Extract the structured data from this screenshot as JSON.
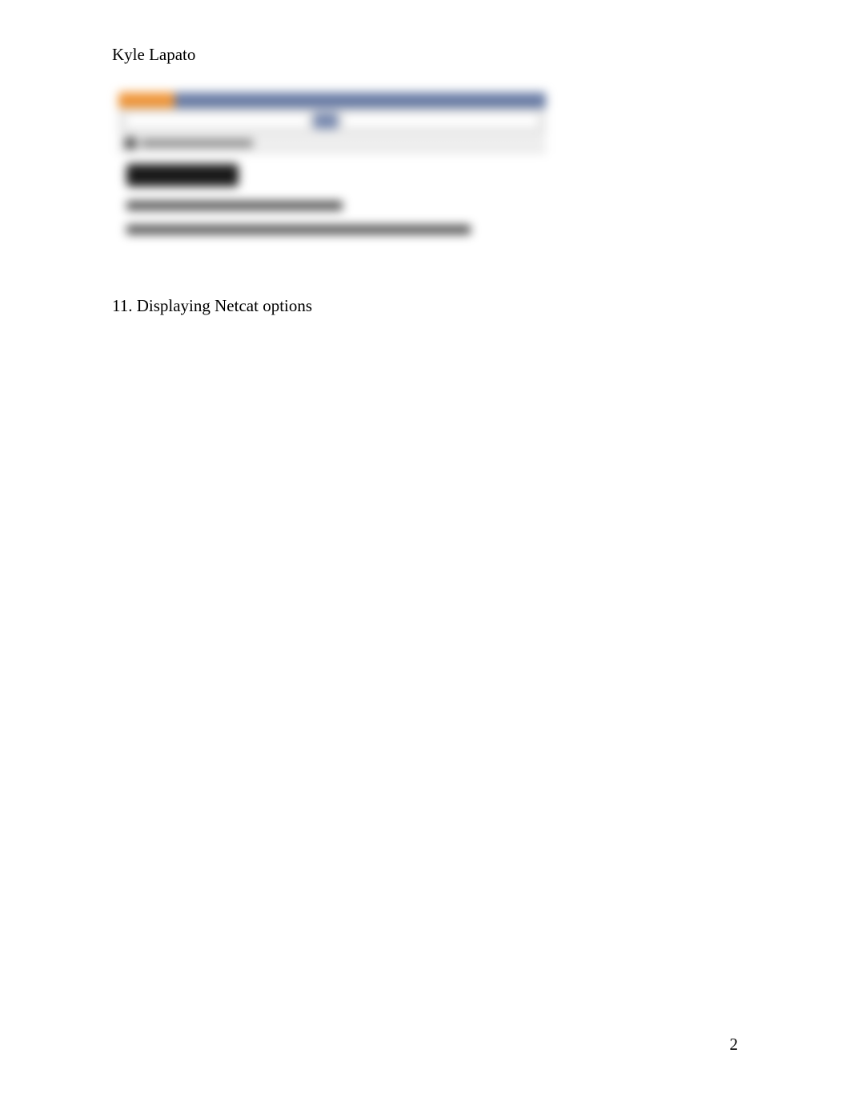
{
  "header": {
    "author_name": "Kyle Lapato"
  },
  "embedded_screenshot": {
    "heading": "It works!",
    "line1": "This is the default web page for this server.",
    "line2": "The web server software is running but no content has been added, yet."
  },
  "section": {
    "number": "11.",
    "title": "Displaying Netcat options"
  },
  "footer": {
    "page_number": "2"
  }
}
